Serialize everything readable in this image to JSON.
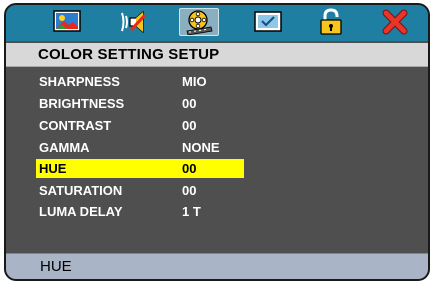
{
  "menu": {
    "tabs": [
      {
        "icon": "picture-icon",
        "active": false
      },
      {
        "icon": "audio-speaker-icon",
        "active": false
      },
      {
        "icon": "film-reel-icon",
        "active": true
      },
      {
        "icon": "display-check-icon",
        "active": false
      },
      {
        "icon": "padlock-icon",
        "active": false
      },
      {
        "icon": "close-x-icon",
        "active": false
      }
    ],
    "title": "COLOR SETTING SETUP",
    "items": [
      {
        "label": "SHARPNESS",
        "value": "MIO"
      },
      {
        "label": "BRIGHTNESS",
        "value": "00"
      },
      {
        "label": "CONTRAST",
        "value": "00"
      },
      {
        "label": "GAMMA",
        "value": "NONE"
      },
      {
        "label": "HUE",
        "value": "00",
        "selected": true
      },
      {
        "label": "SATURATION",
        "value": "00"
      },
      {
        "label": "LUMA DELAY",
        "value": "1 T"
      }
    ],
    "status": "HUE"
  },
  "colors": {
    "topbar": "#1e7fa3",
    "panel": "#4f4f4f",
    "highlight": "#ffff00",
    "statusbar": "#a9b4c6"
  }
}
